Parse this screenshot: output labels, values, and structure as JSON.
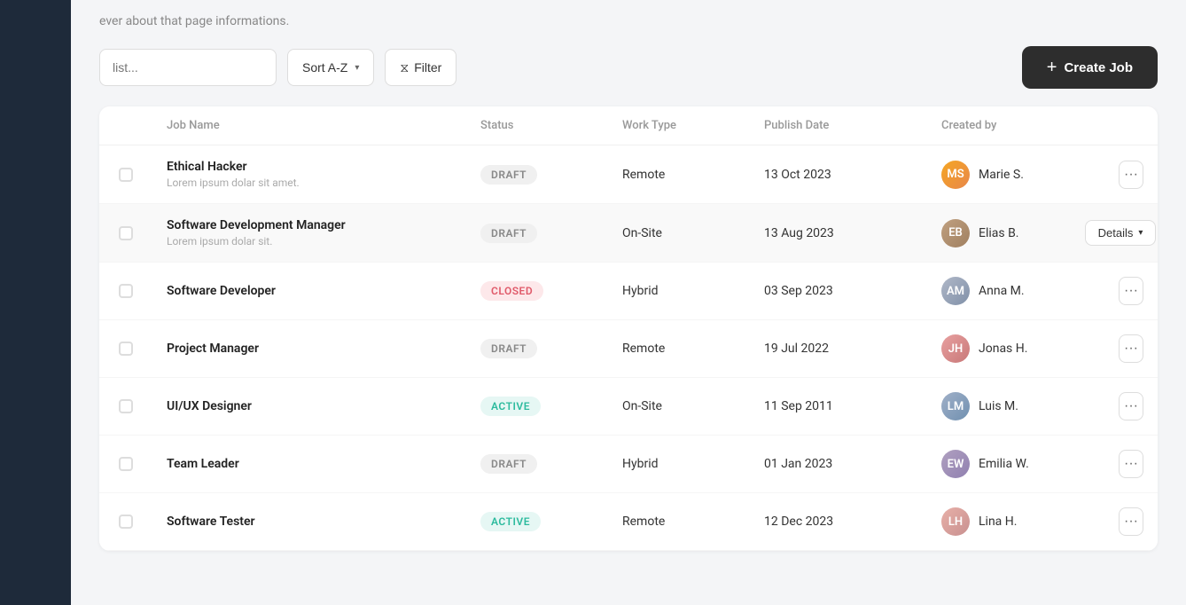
{
  "page": {
    "subtitle": "ever about that page informations.",
    "search_placeholder": "list...",
    "sort_label": "Sort A-Z",
    "filter_label": "Filter",
    "create_job_label": "Create Job"
  },
  "table": {
    "headers": [
      "",
      "Job Name",
      "Status",
      "Work Type",
      "Publish Date",
      "Created by",
      ""
    ],
    "rows": [
      {
        "id": 1,
        "job_name": "Ethical Hacker",
        "job_subtitle": "Lorem ipsum dolar sit amet.",
        "status": "DRAFT",
        "status_type": "draft",
        "work_type": "Remote",
        "publish_date": "13 Oct 2023",
        "creator": "Marie S.",
        "avatar_initials": "MS",
        "avatar_class": "avatar-1",
        "has_details": false
      },
      {
        "id": 2,
        "job_name": "Software Development Manager",
        "job_subtitle": "Lorem ipsum dolar sit.",
        "status": "DRAFT",
        "status_type": "draft",
        "work_type": "On-Site",
        "publish_date": "13 Aug 2023",
        "creator": "Elias B.",
        "avatar_initials": "EB",
        "avatar_class": "avatar-2",
        "has_details": true
      },
      {
        "id": 3,
        "job_name": "Software Developer",
        "job_subtitle": "",
        "status": "CLOSED",
        "status_type": "closed",
        "work_type": "Hybrid",
        "publish_date": "03 Sep 2023",
        "creator": "Anna M.",
        "avatar_initials": "AM",
        "avatar_class": "avatar-3",
        "has_details": false
      },
      {
        "id": 4,
        "job_name": "Project Manager",
        "job_subtitle": "",
        "status": "DRAFT",
        "status_type": "draft",
        "work_type": "Remote",
        "publish_date": "19 Jul 2022",
        "creator": "Jonas H.",
        "avatar_initials": "JH",
        "avatar_class": "avatar-4",
        "has_details": false
      },
      {
        "id": 5,
        "job_name": "UI/UX Designer",
        "job_subtitle": "",
        "status": "ACTIVE",
        "status_type": "active",
        "work_type": "On-Site",
        "publish_date": "11 Sep 2011",
        "creator": "Luis M.",
        "avatar_initials": "LM",
        "avatar_class": "avatar-5",
        "has_details": false
      },
      {
        "id": 6,
        "job_name": "Team Leader",
        "job_subtitle": "",
        "status": "DRAFT",
        "status_type": "draft",
        "work_type": "Hybrid",
        "publish_date": "01 Jan 2023",
        "creator": "Emilia W.",
        "avatar_initials": "EW",
        "avatar_class": "avatar-6",
        "has_details": false
      },
      {
        "id": 7,
        "job_name": "Software Tester",
        "job_subtitle": "",
        "status": "ACTIVE",
        "status_type": "active",
        "work_type": "Remote",
        "publish_date": "12 Dec 2023",
        "creator": "Lina H.",
        "avatar_initials": "LH",
        "avatar_class": "avatar-7",
        "has_details": false
      }
    ]
  }
}
